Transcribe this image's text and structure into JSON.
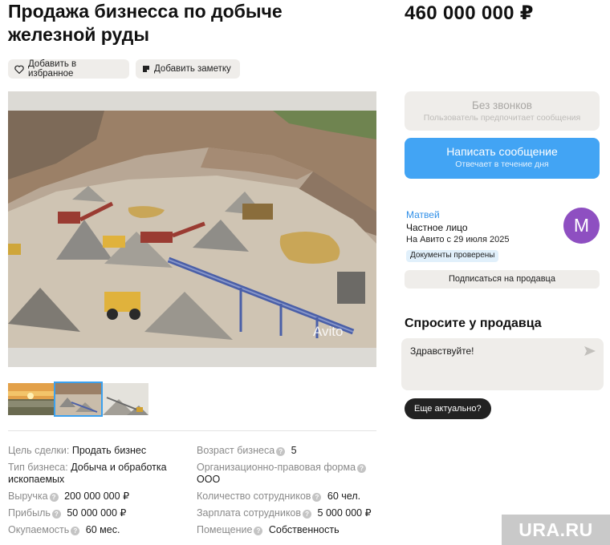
{
  "listing": {
    "title": "Продажа бизнесса по добыче железной руды",
    "price": "460 000 000 ₽"
  },
  "actions": {
    "favorite_label": "Добавить в избранное",
    "note_label": "Добавить заметку"
  },
  "gallery": {
    "watermark": "Avito",
    "thumbnails": [
      "sunset-landscape",
      "quarry",
      "conveyor"
    ],
    "active_thumbnail": 1
  },
  "params": {
    "deal_goal": {
      "key": "Цель сделки:",
      "value": "Продать бизнес"
    },
    "business_type": {
      "key": "Тип бизнеса:",
      "value": "Добыча и обработка ископаемых"
    },
    "revenue": {
      "key": "Выручка",
      "value": "200 000 000 ₽"
    },
    "profit": {
      "key": "Прибыль",
      "value": "50 000 000 ₽"
    },
    "payback": {
      "key": "Окупаемость",
      "value": "60 мес."
    },
    "age": {
      "key": "Возраст бизнеса",
      "value": "5"
    },
    "legal_form": {
      "key": "Организационно-правовая форма",
      "value": "ООО"
    },
    "employees": {
      "key": "Количество сотрудников",
      "value": "60 чел."
    },
    "salary": {
      "key": "Зарплата сотрудников",
      "value": "5 000 000 ₽"
    },
    "premises": {
      "key": "Помещение",
      "value": "Собственность"
    }
  },
  "contact": {
    "no_calls_title": "Без звонков",
    "no_calls_sub": "Пользователь предпочитает сообщения",
    "write_title": "Написать сообщение",
    "write_sub": "Отвечает в течение дня"
  },
  "seller": {
    "name": "Матвей",
    "type": "Частное лицо",
    "since": "На Авито с 29 июля 2025",
    "badge": "Документы проверены",
    "avatar_letter": "М",
    "avatar_color": "#8e4fc1",
    "subscribe_label": "Подписаться на продавца"
  },
  "ask": {
    "title": "Спросите у продавца",
    "message": "Здравствуйте!",
    "quick_reply": "Еще актуально?"
  },
  "watermark": "URA.RU",
  "colors": {
    "accent_blue": "#42a4f4",
    "seller_link": "#2f8fe8",
    "button_gray": "#efedea"
  }
}
